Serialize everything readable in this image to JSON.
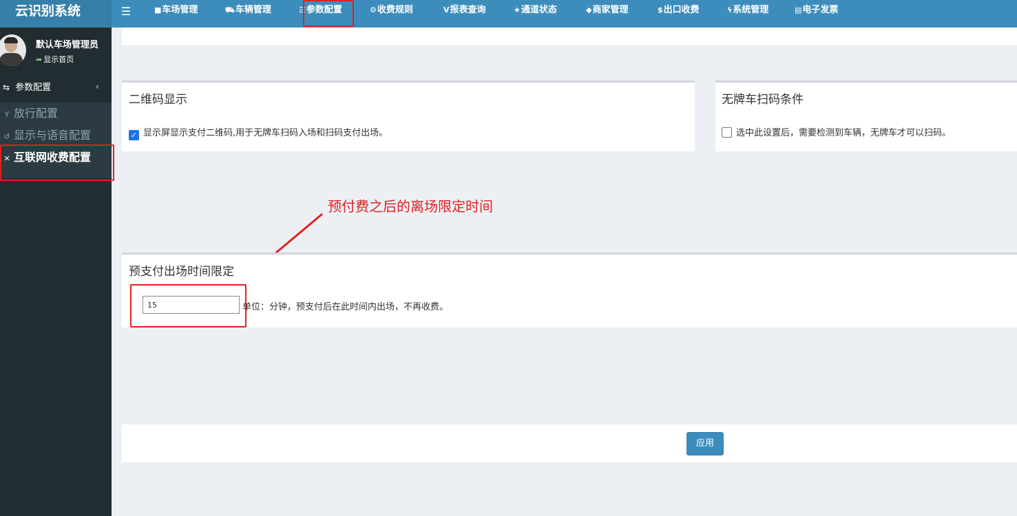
{
  "app": {
    "title": "云识别系统"
  },
  "nav": {
    "items": [
      {
        "icon": "car-icon",
        "glyph": "■",
        "label": "车场管理"
      },
      {
        "icon": "car-icon",
        "glyph": "⛟",
        "label": "车辆管理"
      },
      {
        "icon": "sliders-icon",
        "glyph": "☰",
        "label": "参数配置"
      },
      {
        "icon": "gears-icon",
        "glyph": "⚙",
        "label": "收费规则"
      },
      {
        "icon": "chart-icon",
        "glyph": "V",
        "label": "报表查询"
      },
      {
        "icon": "star-icon",
        "glyph": "★",
        "label": "通道状态"
      },
      {
        "icon": "tag-icon",
        "glyph": "◆",
        "label": "商家管理"
      },
      {
        "icon": "money-icon",
        "glyph": "$",
        "label": "出口收费"
      },
      {
        "icon": "bolt-icon",
        "glyph": "ϟ",
        "label": "系统管理"
      },
      {
        "icon": "invoice-icon",
        "glyph": "▤",
        "label": "电子发票"
      }
    ]
  },
  "user": {
    "name": "默认车场管理员",
    "link": "显示首页"
  },
  "sidebar": {
    "section": "参数配置",
    "items": [
      {
        "icon": "y-icon",
        "glyph": "Y",
        "label": "放行配置"
      },
      {
        "icon": "history-icon",
        "glyph": "↺",
        "label": "显示与语音配置"
      },
      {
        "icon": "fees-icon",
        "glyph": "✕",
        "label": "互联网收费配置"
      }
    ]
  },
  "qr_panel": {
    "title": "二维码显示",
    "option": "显示屏显示支付二维码,用于无牌车扫码入场和扫码支付出场。",
    "checked": true
  },
  "unlicensed_panel": {
    "title": "无牌车扫码条件",
    "option": "选中此设置后，需要检测到车辆，无牌车才可以扫码。",
    "checked": false
  },
  "prepay_panel": {
    "title": "预支付出场时间限定",
    "minutes_value": "15",
    "unit_note": "单位：分钟，预支付后在此时间内出场，不再收费。"
  },
  "actions": {
    "apply_label": "应用"
  },
  "annotation": {
    "text": "预付费之后的离场限定时间",
    "color": "#e02020"
  },
  "colors": {
    "topbar": "#3c8dbc",
    "sidebar": "#222d32",
    "accent": "#3c8dbc"
  }
}
